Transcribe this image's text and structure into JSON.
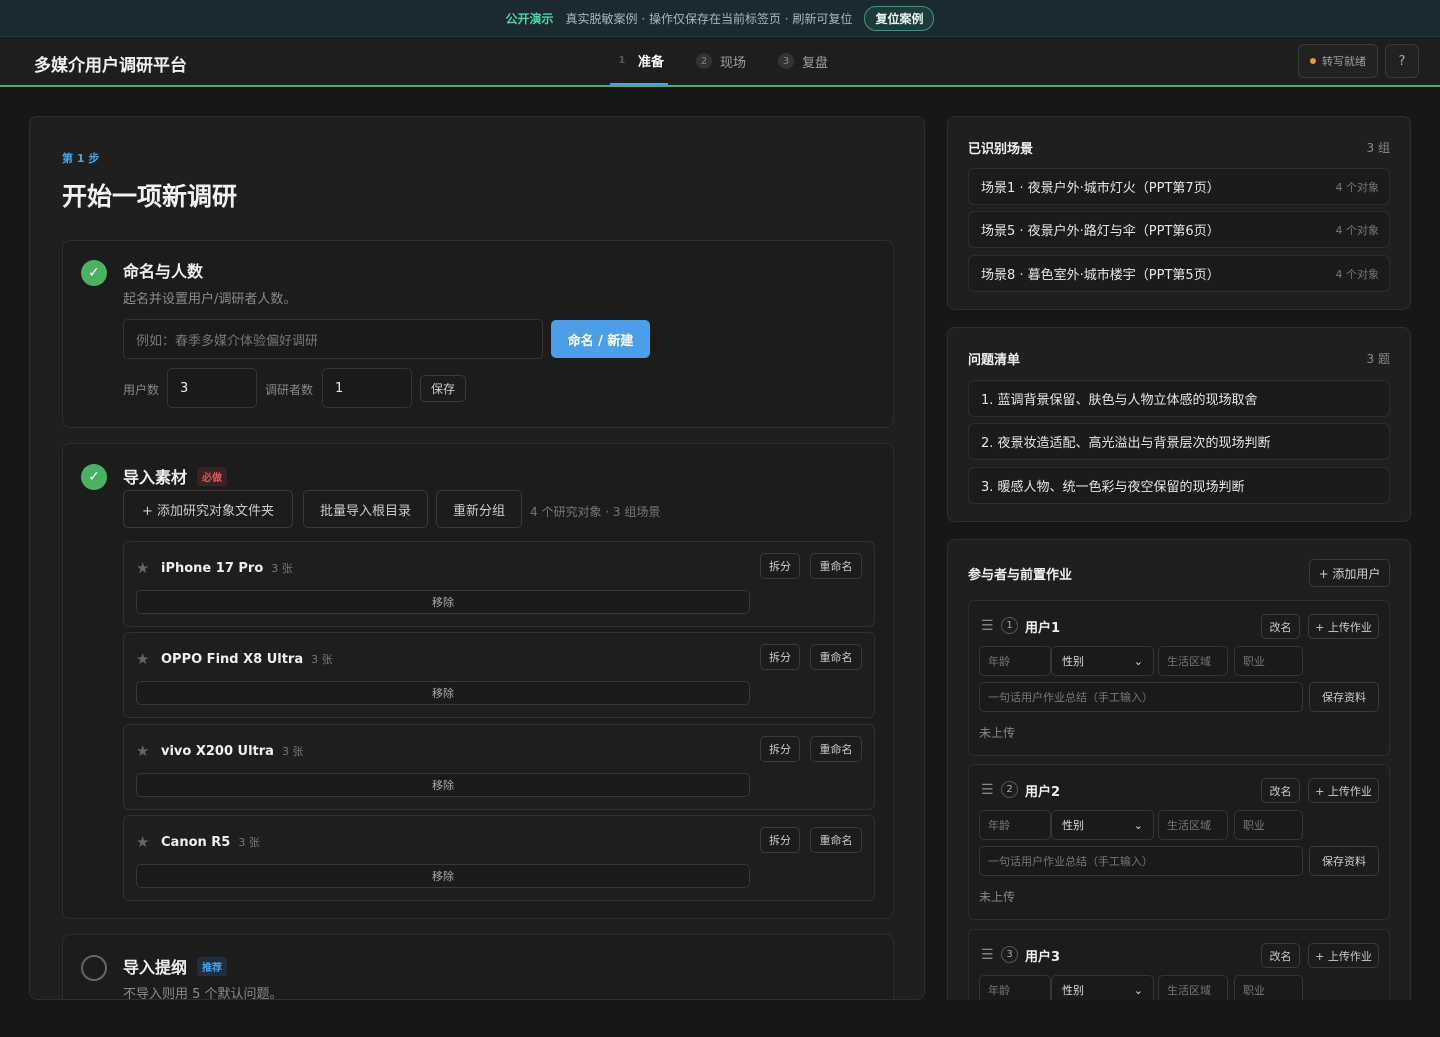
{
  "banner": {
    "tag": "公开演示",
    "text": "真实脱敏案例 · 操作仅保存在当前标签页 · 刷新可复位",
    "reset_label": "复位案例"
  },
  "header": {
    "title": "多媒介用户调研平台",
    "steps": [
      {
        "num": "1",
        "label": "准备",
        "active": true
      },
      {
        "num": "2",
        "label": "现场",
        "active": false
      },
      {
        "num": "3",
        "label": "复盘",
        "active": false
      }
    ],
    "status": "转写就绪",
    "help": "?"
  },
  "main": {
    "step_label": "第 1 步",
    "title": "开始一项新调研",
    "naming": {
      "title": "命名与人数",
      "desc": "起名并设置用户/调研者人数。",
      "name_placeholder": "例如：春季多媒介体验偏好调研",
      "create_label": "命名 / 新建",
      "users_label": "用户数",
      "users_value": "3",
      "researchers_label": "调研者数",
      "researchers_value": "1",
      "save_label": "保存"
    },
    "import": {
      "title": "导入素材",
      "required": "必做",
      "add_folder": "+ 添加研究对象文件夹",
      "batch_import": "批量导入根目录",
      "regroup": "重新分组",
      "meta": "4 个研究对象 · 3 组场景",
      "split_label": "拆分",
      "rename_label": "重命名",
      "remove_label": "移除",
      "devices": [
        {
          "name": "iPhone 17 Pro",
          "count": "3 张"
        },
        {
          "name": "OPPO Find X8 Ultra",
          "count": "3 张"
        },
        {
          "name": "vivo X200 Ultra",
          "count": "3 张"
        },
        {
          "name": "Canon R5",
          "count": "3 张"
        }
      ]
    },
    "outline": {
      "title": "导入提纲",
      "recommended": "推荐",
      "desc": "不导入则用 5 个默认问题。"
    }
  },
  "scenes": {
    "title": "已识别场景",
    "count": "3 组",
    "items": [
      {
        "label": "场景1 · 夜景户外·城市灯火（PPT第7页）",
        "objects": "4 个对象"
      },
      {
        "label": "场景5 · 夜景户外·路灯与伞（PPT第6页）",
        "objects": "4 个对象"
      },
      {
        "label": "场景8 · 暮色室外·城市楼宇（PPT第5页）",
        "objects": "4 个对象"
      }
    ]
  },
  "questions": {
    "title": "问题清单",
    "count": "3 题",
    "items": [
      "1. 蓝调背景保留、肤色与人物立体感的现场取舍",
      "2. 夜景妆造适配、高光溢出与背景层次的现场判断",
      "3. 暖感人物、统一色彩与夜空保留的现场判断"
    ]
  },
  "participants": {
    "title": "参与者与前置作业",
    "add_user": "+ 添加用户",
    "rename_label": "改名",
    "upload_label": "+ 上传作业",
    "age_placeholder": "年龄",
    "gender_value": "性别",
    "region_placeholder": "生活区域",
    "job_placeholder": "职业",
    "summary_placeholder": "一句话用户作业总结（手工输入）",
    "save_label": "保存资料",
    "status": "未上传",
    "users": [
      {
        "num": "1",
        "name": "用户1"
      },
      {
        "num": "2",
        "name": "用户2"
      },
      {
        "num": "3",
        "name": "用户3"
      }
    ]
  },
  "colors": {
    "accent": "#4a9fe8",
    "success": "#4bb263",
    "banner_tag": "#47d6a6",
    "required": "#e05a5a",
    "status_dot": "#e0a030"
  }
}
